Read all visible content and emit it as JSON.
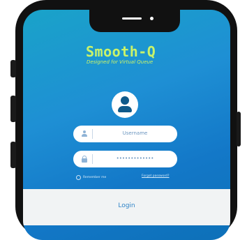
{
  "brand": {
    "name": "Smooth-Q",
    "tagline": "Designed for Virtual Queue"
  },
  "form": {
    "username": {
      "placeholder": "Username",
      "icon": "user-icon"
    },
    "password": {
      "value": "•••••••••••••",
      "icon": "lock-icon"
    },
    "remember_label": "Remember me",
    "forgot_label": "Forgot password?"
  },
  "login": {
    "label": "Login"
  },
  "colors": {
    "accent": "#c9f36a",
    "gradient_top": "#1aa3c9",
    "gradient_bottom": "#0d70b8",
    "avatar_icon": "#0f5a8a",
    "login_text": "#2f83c7"
  }
}
